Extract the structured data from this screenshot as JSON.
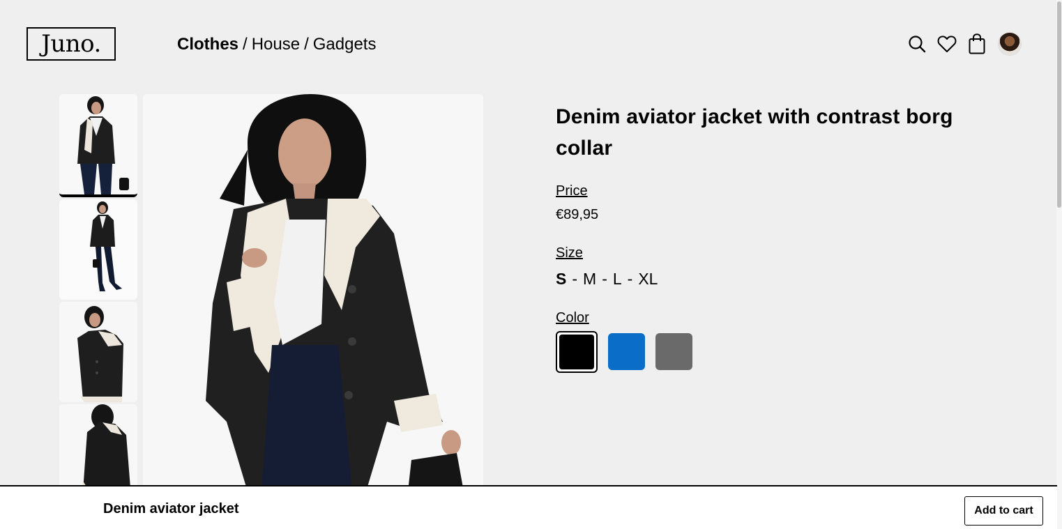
{
  "brand": {
    "logo_text": "Juno."
  },
  "nav": {
    "categories": [
      "Clothes",
      "House",
      "Gadgets"
    ],
    "separator": "/",
    "active": "Clothes"
  },
  "header_icons": [
    "search-icon",
    "heart-icon",
    "shopping-bag-icon",
    "user-avatar"
  ],
  "product": {
    "title": "Denim aviator jacket with contrast borg collar",
    "price_label": "Price",
    "price": "€89,95",
    "size_label": "Size",
    "sizes": [
      "S",
      "M",
      "L",
      "XL"
    ],
    "selected_size": "S",
    "size_separator": "-",
    "color_label": "Color",
    "colors": [
      "#000000",
      "#0a6ec9",
      "#6a6a6a"
    ],
    "selected_color": "#000000"
  },
  "gallery": {
    "thumbnail_count": 4,
    "selected_index": 0
  },
  "sticky_bar": {
    "product_name": "Denim aviator jacket",
    "cta_label": "Add to cart"
  }
}
